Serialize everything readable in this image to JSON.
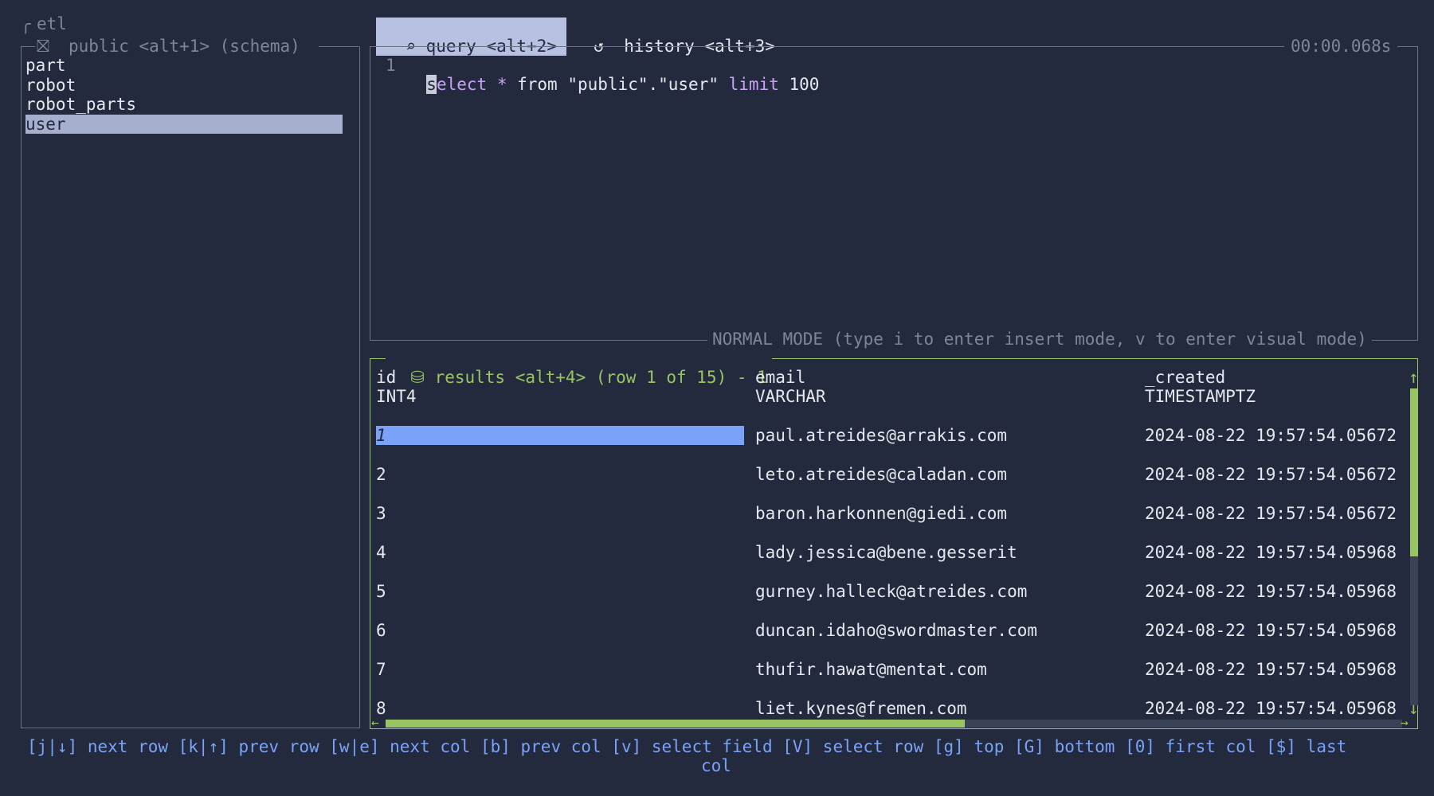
{
  "app_title": "etl",
  "schema_panel": {
    "header_icon": "schema-icon",
    "title": "public <alt+1> (schema)",
    "tables": [
      "part",
      "robot",
      "robot_parts",
      "user"
    ],
    "selected": "user"
  },
  "tabs": [
    {
      "icon": "search-icon",
      "label": "query <alt+2>",
      "active": true
    },
    {
      "icon": "history-icon",
      "label": "history <alt+3>",
      "active": false
    }
  ],
  "timer": "00:00.068s",
  "editor": {
    "line_number": "1",
    "cursor_char": "s",
    "tokens": [
      {
        "text": "elect",
        "cls": "kw"
      },
      {
        "text": " ",
        "cls": ""
      },
      {
        "text": "*",
        "cls": "kw"
      },
      {
        "text": " from \"public\".\"user\" ",
        "cls": ""
      },
      {
        "text": "limit",
        "cls": "kw"
      },
      {
        "text": " 100",
        "cls": ""
      }
    ],
    "mode_text": "NORMAL MODE (type i to enter insert mode, v to enter visual mode)"
  },
  "results": {
    "icon": "database-icon",
    "title": "results <alt+4> (row 1 of 15) - 1",
    "columns": [
      {
        "name": "id",
        "type": "INT4"
      },
      {
        "name": "email",
        "type": "VARCHAR"
      },
      {
        "name": "_created",
        "type": "TIMESTAMPTZ"
      }
    ],
    "rows": [
      [
        "1",
        "paul.atreides@arrakis.com",
        "2024-08-22 19:57:54.05672"
      ],
      [
        "2",
        "leto.atreides@caladan.com",
        "2024-08-22 19:57:54.05672"
      ],
      [
        "3",
        "baron.harkonnen@giedi.com",
        "2024-08-22 19:57:54.05672"
      ],
      [
        "4",
        "lady.jessica@bene.gesserit",
        "2024-08-22 19:57:54.05968"
      ],
      [
        "5",
        "gurney.halleck@atreides.com",
        "2024-08-22 19:57:54.05968"
      ],
      [
        "6",
        "duncan.idaho@swordmaster.com",
        "2024-08-22 19:57:54.05968"
      ],
      [
        "7",
        "thufir.hawat@mentat.com",
        "2024-08-22 19:57:54.05968"
      ],
      [
        "8",
        "liet.kynes@fremen.com",
        "2024-08-22 19:57:54.05968"
      ]
    ],
    "selected_row": 0,
    "scroll_up_arrow": "↑",
    "scroll_down_arrow": "↓",
    "scroll_left_arrow": "←",
    "scroll_right_arrow": "→",
    "vertical_scroll_fraction": 0.53,
    "horizontal_scroll_fraction": 0.57
  },
  "help_bar": {
    "line1": "[j|↓] next row [k|↑] prev row [w|e] next col [b] prev col [v] select field [V] select row [g] top [G] bottom [0] first col [$] last",
    "line2": "col"
  },
  "colors": {
    "background": "#232a3d",
    "accent_green": "#98c463",
    "selection_blue": "#7aa2f7",
    "keyword_purple": "#c8a2f5"
  }
}
